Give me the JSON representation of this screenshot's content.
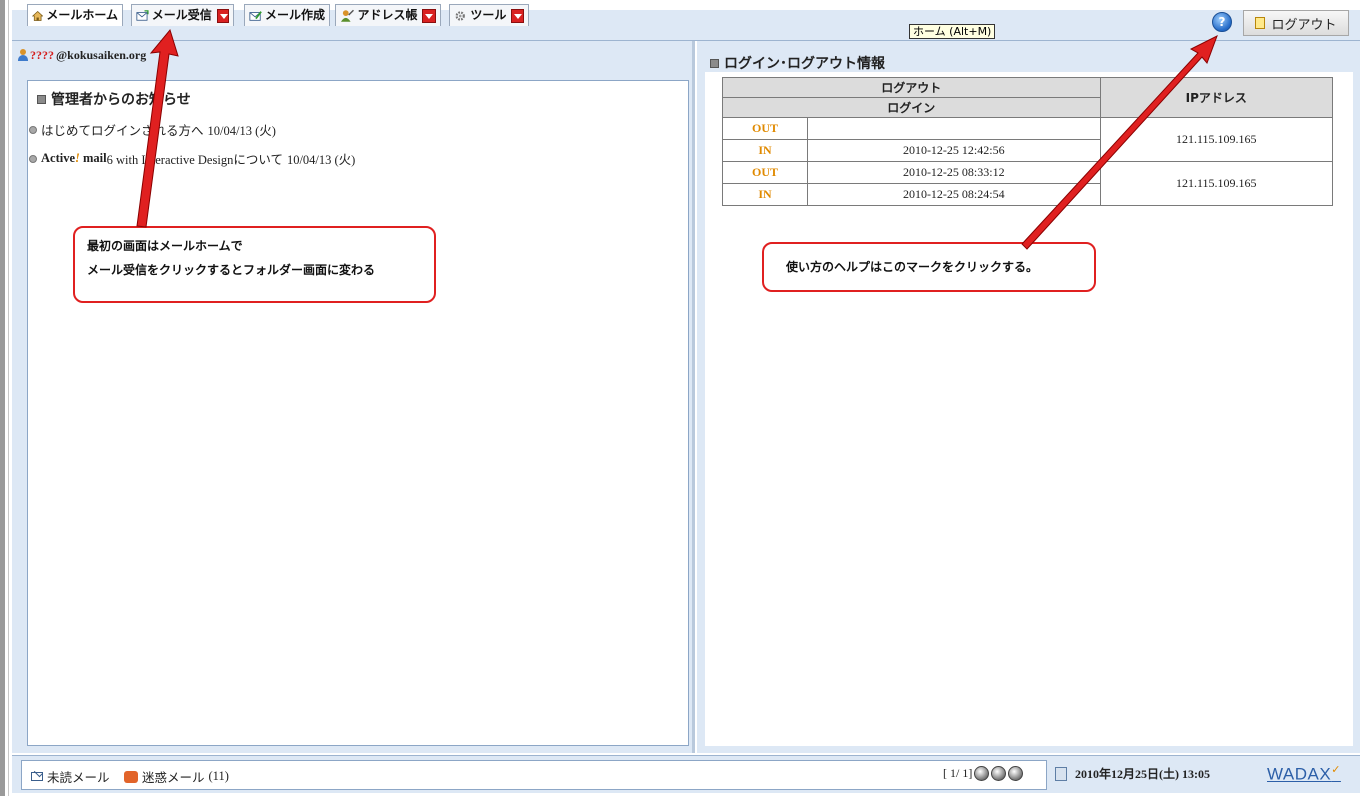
{
  "toolbar": {
    "tabs": [
      {
        "label": "メールホーム",
        "icon": "home-icon"
      },
      {
        "label": "メール受信",
        "icon": "mail-receive-icon"
      },
      {
        "label": "メール作成",
        "icon": "mail-compose-icon"
      },
      {
        "label": "アドレス帳",
        "icon": "address-book-icon"
      },
      {
        "label": "ツール",
        "icon": "tools-icon"
      }
    ],
    "tooltip": "ホーム (Alt+M)",
    "help_icon": "help-icon",
    "help_glyph": "?",
    "logout_label": "ログアウト"
  },
  "user": {
    "name_prefix": "????",
    "email": "@kokusaiken.org"
  },
  "notices": {
    "title": "管理者からのお知らせ",
    "items": [
      {
        "text": "はじめてログインされる方へ",
        "date": "10/04/13 (火)"
      },
      {
        "brand_a": "Active",
        "brand_mark": "!",
        "brand_b": " mail",
        "text": " 6 with Interactive Designについて",
        "date": "10/04/13 (火)"
      }
    ]
  },
  "login_info": {
    "title": "ログイン･ログアウト情報",
    "headers": {
      "logout": "ログアウト",
      "login": "ログイン",
      "ip": "IPアドレス"
    },
    "rows": [
      {
        "kind": "OUT",
        "time": "",
        "ip": "121.115.109.165"
      },
      {
        "kind": "IN",
        "time": "2010-12-25 12:42:56"
      },
      {
        "kind": "OUT",
        "time": "2010-12-25 08:33:12",
        "ip": "121.115.109.165"
      },
      {
        "kind": "IN",
        "time": "2010-12-25 08:24:54"
      }
    ]
  },
  "annotations": {
    "left": {
      "line1": "最初の画面はメールホームで",
      "line2": "メール受信をクリックするとフォルダー画面に変わる"
    },
    "right": {
      "line1": "使い方のヘルプはこのマークをクリックする。"
    },
    "color": "#e02020"
  },
  "status": {
    "unread": "未読メール",
    "spam": "迷惑メール",
    "spam_count": "(11)",
    "pager": "[ 1/ 1]",
    "datetime": "2010年12月25日(土) 13:05",
    "brand": "WADAX",
    "brand_mark": "✓"
  },
  "colors": {
    "panel_bg": "#dde8f5",
    "accent_red": "#d92121",
    "kind_orange": "#e08a00"
  }
}
